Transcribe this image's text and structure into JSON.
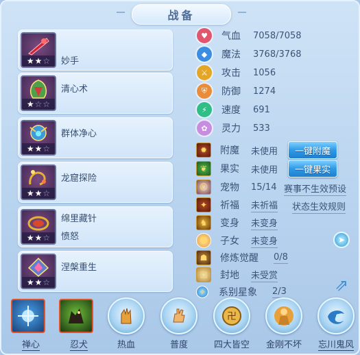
{
  "window": {
    "title": "战备"
  },
  "skills": [
    {
      "name": "妙手",
      "stars_on": 2,
      "stars_total": 3,
      "art_color": "#d8203a"
    },
    {
      "name": "清心术",
      "stars_on": 1,
      "stars_total": 3,
      "art_color": "#4fa04a"
    },
    {
      "name": "群体净心",
      "stars_on": 2,
      "stars_total": 3,
      "art_color": "#3f9ad9"
    },
    {
      "name": "龙窟探险",
      "stars_on": 2,
      "stars_total": 3,
      "art_color": "#e7b233"
    },
    {
      "name": "绵里藏针",
      "sub": "愤怒",
      "stars_on": 2,
      "stars_total": 3,
      "art_color": "#d7482c"
    },
    {
      "name": "涅槃重生",
      "stars_on": 2,
      "stars_total": 3,
      "art_color": "#5f7fd1"
    }
  ],
  "attributes": [
    {
      "label": "气血",
      "value": "7058/7058",
      "icon": "heart-icon",
      "color": "#e2566d"
    },
    {
      "label": "魔法",
      "value": "3768/3768",
      "icon": "diamond-icon",
      "color": "#3a8de0"
    },
    {
      "label": "攻击",
      "value": "1056",
      "icon": "sword-icon",
      "color": "#e3a627"
    },
    {
      "label": "防御",
      "value": "1274",
      "icon": "shield-icon",
      "color": "#e98d3a"
    },
    {
      "label": "速度",
      "value": "691",
      "icon": "lightning-icon",
      "color": "#2fbf86"
    },
    {
      "label": "灵力",
      "value": "533",
      "icon": "flower-icon",
      "color": "#c88de1"
    }
  ],
  "equipment": {
    "enchant": {
      "label": "附魔",
      "status": "未使用",
      "button": "一键附魔"
    },
    "fruit": {
      "label": "果实",
      "status": "未使用",
      "button": "一键果实"
    },
    "pet": {
      "label": "宠物",
      "status": "15/14",
      "link": "赛事不生效预设"
    },
    "pray": {
      "label": "祈福",
      "status": "未祈福",
      "link": "状态生效规则"
    },
    "transform": {
      "label": "变身",
      "status": "未变身"
    },
    "child": {
      "label": "子女",
      "status": "未变身"
    },
    "cultivate": {
      "label": "修炼觉醒",
      "status": "0/8"
    },
    "fief": {
      "label": "封地",
      "status": "未受赏"
    },
    "star": {
      "label": "系别星象",
      "status": "2/3"
    }
  },
  "abilities": [
    {
      "label": "禅心",
      "underlined": true,
      "style": "square",
      "glyph": "✦",
      "color": "#8fd0ff"
    },
    {
      "label": "忍犬",
      "underlined": true,
      "style": "square",
      "glyph": "🐺",
      "color": "#b9e36a"
    },
    {
      "label": "热血",
      "underlined": false,
      "style": "circle",
      "glyph": "✋",
      "color": "#e7a13a"
    },
    {
      "label": "普度",
      "underlined": false,
      "style": "circle",
      "glyph": "✋",
      "color": "#f0b56a"
    },
    {
      "label": "四大皆空",
      "underlined": false,
      "style": "circle",
      "glyph": "卍",
      "color": "#d89b2c"
    },
    {
      "label": "金刚不坏",
      "underlined": false,
      "style": "circle",
      "glyph": "☸",
      "color": "#d9a233"
    },
    {
      "label": "忘川鬼风",
      "underlined": true,
      "style": "circle",
      "glyph": "◉",
      "color": "#3aa2d8"
    }
  ]
}
